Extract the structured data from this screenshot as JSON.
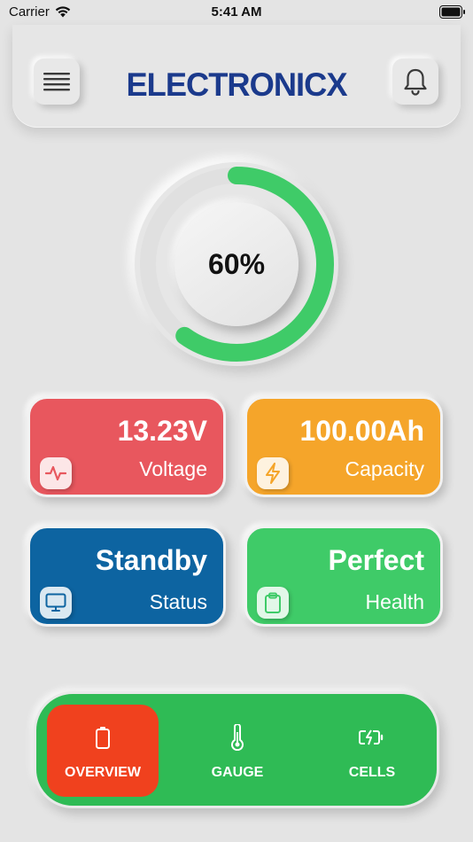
{
  "status_bar": {
    "carrier": "Carrier",
    "time": "5:41 AM"
  },
  "header": {
    "logo_text": "ELECTRONICX",
    "menu_icon": "hamburger-menu-icon",
    "bell_icon": "bell-icon"
  },
  "gauge": {
    "label": "60%",
    "level_fraction": 0.6,
    "accent_color": "#3fcb68"
  },
  "tiles": {
    "voltage": {
      "value": "13.23V",
      "label": "Voltage",
      "icon": "pulse-icon",
      "color": "#e8575e"
    },
    "capacity": {
      "value": "100.00Ah",
      "label": "Capacity",
      "icon": "lightning-icon",
      "color": "#f5a52a"
    },
    "status": {
      "value": "Standby",
      "label": "Status",
      "icon": "monitor-icon",
      "color": "#0d64a1"
    },
    "health": {
      "value": "Perfect",
      "label": "Health",
      "icon": "clipboard-icon",
      "color": "#3fcb68"
    }
  },
  "nav": {
    "items": [
      {
        "label": "OVERVIEW",
        "icon": "battery-icon",
        "active": true
      },
      {
        "label": "GAUGE",
        "icon": "thermometer-icon",
        "active": false
      },
      {
        "label": "CELLS",
        "icon": "battery-charging-icon",
        "active": false
      }
    ],
    "bar_color": "#2fbb55",
    "active_color": "#f0411e"
  }
}
